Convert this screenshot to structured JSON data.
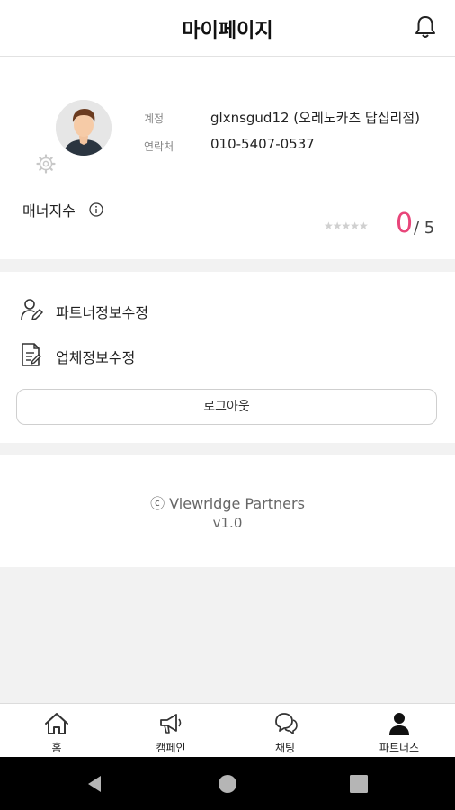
{
  "header": {
    "title": "마이페이지",
    "bell_icon": "bell-icon"
  },
  "profile": {
    "account_label": "계정",
    "account_value": "glxnsgud12 (오레노카츠 답십리점)",
    "contact_label": "연락처",
    "contact_value": "010-5407-0537",
    "manner_label": "매너지수",
    "stars": "★★★★★",
    "score": "0",
    "score_max": "/ 5",
    "rating": 0
  },
  "menu": {
    "partner_edit": "파트너정보수정",
    "company_edit": "업체정보수정",
    "logout": "로그아웃"
  },
  "footer": {
    "copyright": "ⓒ Viewridge Partners",
    "version": "v1.0"
  },
  "nav": [
    {
      "label": "홈",
      "icon": "home-icon"
    },
    {
      "label": "캠페인",
      "icon": "megaphone-icon"
    },
    {
      "label": "채팅",
      "icon": "chat-icon"
    },
    {
      "label": "파트너스",
      "icon": "person-icon"
    }
  ],
  "colors": {
    "accent": "#e8457a"
  }
}
